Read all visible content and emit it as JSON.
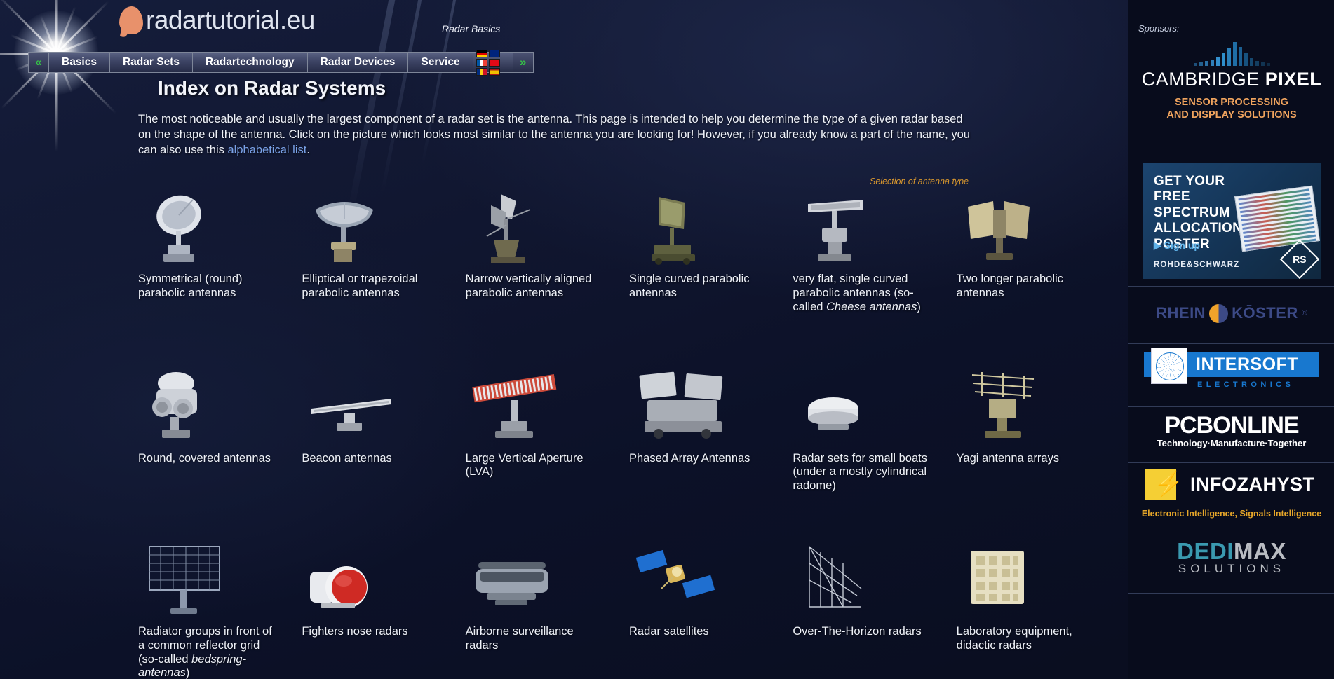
{
  "site": {
    "logo_text": "radartutorial.eu",
    "subtitle": "Radar Basics"
  },
  "nav": {
    "prev_arrow": "«",
    "next_arrow": "»",
    "items": [
      {
        "label": "Basics"
      },
      {
        "label": "Radar Sets"
      },
      {
        "label": "Radartechnology"
      },
      {
        "label": "Radar Devices"
      },
      {
        "label": "Service"
      }
    ],
    "flags": [
      {
        "name": "flag-germany",
        "colors": [
          "#000000",
          "#dd0000",
          "#ffce00"
        ]
      },
      {
        "name": "flag-united-kingdom",
        "colors": [
          "#00247d",
          "#ffffff",
          "#cf142b"
        ]
      },
      {
        "name": "flag-france",
        "colors": [
          "#0055a4",
          "#ffffff",
          "#ef4135"
        ]
      },
      {
        "name": "flag-turkey",
        "colors": [
          "#e30a17",
          "#ffffff",
          "#e30a17"
        ]
      },
      {
        "name": "flag-romania",
        "colors": [
          "#002b7f",
          "#fcd116",
          "#ce1126"
        ]
      },
      {
        "name": "flag-spain",
        "colors": [
          "#aa151b",
          "#f1bf00",
          "#aa151b"
        ]
      }
    ]
  },
  "main": {
    "title": "Index on Radar Systems",
    "intro_part1": "The most noticeable and usually the largest component of a radar set is the antenna. This page is intended to help you determine the type of a given radar based on the shape of the antenna. Click on the picture which looks most similar to the antenna you are looking for! However, if you already know a part of the name, you can also use this ",
    "intro_link": "alphabetical list",
    "intro_part2": ".",
    "selection_note": "Selection of antenna type",
    "antennas": [
      {
        "caption": "Symmetrical (round) parabolic antennas",
        "icon": "round-parabolic-dish-icon"
      },
      {
        "caption": "Elliptical or trapezoidal parabolic antennas",
        "icon": "elliptical-parabolic-dish-icon"
      },
      {
        "caption": "Narrow vertically aligned parabolic antennas",
        "icon": "narrow-vertical-parabolic-icon"
      },
      {
        "caption": "Single curved parabolic antennas",
        "icon": "single-curved-parabolic-icon"
      },
      {
        "caption_pre": "very flat, single curved parabolic antennas (so-called ",
        "caption_em": "Cheese antennas",
        "caption_post": ")",
        "caption": "very flat, single curved parabolic antennas (so-called Cheese antennas)",
        "icon": "cheese-antenna-icon"
      },
      {
        "caption": "Two longer parabolic antennas",
        "icon": "two-longer-parabolic-icon"
      },
      {
        "caption": "Round, covered antennas",
        "icon": "round-covered-antenna-icon"
      },
      {
        "caption": "Beacon antennas",
        "icon": "beacon-antenna-icon"
      },
      {
        "caption": "Large Vertical Aperture (LVA)",
        "icon": "lva-antenna-icon"
      },
      {
        "caption": "Phased Array Antennas",
        "icon": "phased-array-antenna-icon"
      },
      {
        "caption": "Radar sets for small boats (under a mostly cylindrical radome)",
        "icon": "small-boat-radar-icon"
      },
      {
        "caption": "Yagi antenna arrays",
        "icon": "yagi-antenna-array-icon"
      },
      {
        "caption_pre": "Radiator groups in front of a common reflector grid (so-called ",
        "caption_em": "bedspring-antennas",
        "caption_post": ")",
        "caption": "Radiator groups in front of a common reflector grid (so-called bedspring-antennas)",
        "icon": "bedspring-antenna-icon"
      },
      {
        "caption": "Fighters nose radars",
        "icon": "fighter-nose-radar-icon"
      },
      {
        "caption": "Airborne surveillance radars",
        "icon": "airborne-surveillance-radar-icon"
      },
      {
        "caption": "Radar satellites",
        "icon": "radar-satellite-icon"
      },
      {
        "caption": "Over-The-Horizon radars",
        "icon": "over-the-horizon-radar-icon"
      },
      {
        "caption": "Laboratory equipment, didactic radars",
        "icon": "laboratory-radar-icon"
      }
    ]
  },
  "sidebar": {
    "label": "Sponsors:",
    "sponsors": [
      {
        "id": "cambridge-pixel",
        "name_light": "CAMBRIDGE ",
        "name_bold": "PIXEL",
        "tagline_line1": "SENSOR PROCESSING",
        "tagline_line2": "AND DISPLAY SOLUTIONS",
        "accent": "#f0a45e"
      },
      {
        "id": "rohde-schwarz",
        "headline": "GET YOUR FREE SPECTRUM ALLOCATION POSTER",
        "cta": "▶ Sign up",
        "brand": "ROHDE&SCHWARZ",
        "monogram": "RS",
        "accent": "#5fb2e8"
      },
      {
        "id": "rhein-koster",
        "word1": "RHEIN",
        "word2": "KŌSTER",
        "registered": "®",
        "accent": "#3c4a86"
      },
      {
        "id": "intersoft-electronics",
        "name": "INTERSOFT",
        "sub": "ELECTRONICS",
        "accent": "#1878cf"
      },
      {
        "id": "pcbonline",
        "name": "PCBONLINE",
        "sub": "Technology·Manufacture·Together",
        "accent": "#ffffff"
      },
      {
        "id": "infozahyst",
        "name": "INFOZAHYST",
        "sub": "Electronic Intelligence, Signals Intelligence",
        "accent": "#f5cf34"
      },
      {
        "id": "dedimax-solutions",
        "name_a": "DEDI",
        "name_b": "MAX",
        "sub": "SOLUTIONS",
        "accent": "#3a9ab0"
      }
    ]
  }
}
